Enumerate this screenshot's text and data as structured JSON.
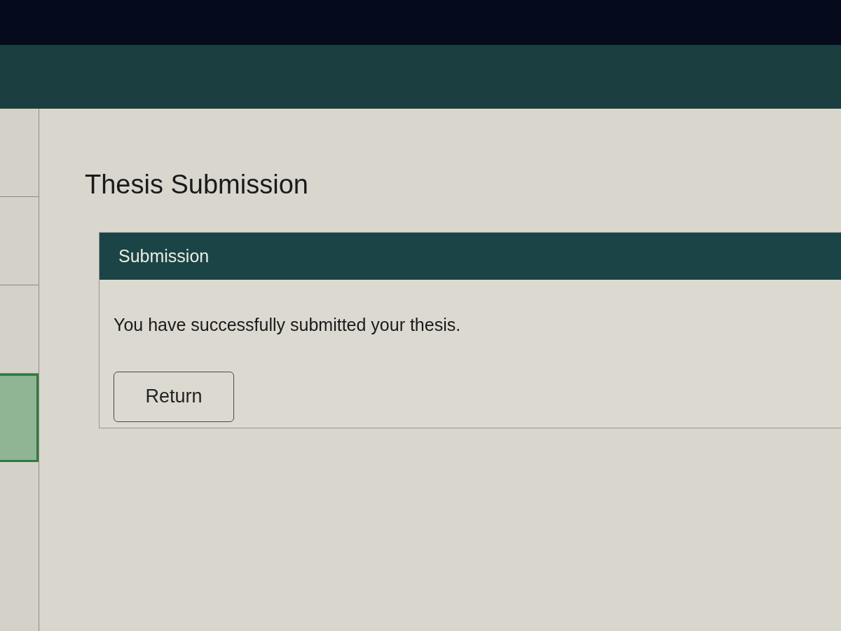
{
  "sidebar": {
    "items": [
      {
        "selected": false
      },
      {
        "selected": false
      },
      {
        "selected": false
      },
      {
        "selected": true
      }
    ]
  },
  "page_title": "Thesis Submission",
  "panel": {
    "title": "Submission",
    "message": "You have successfully submitted your thesis.",
    "buttons": [
      {
        "label": "Return"
      }
    ]
  }
}
